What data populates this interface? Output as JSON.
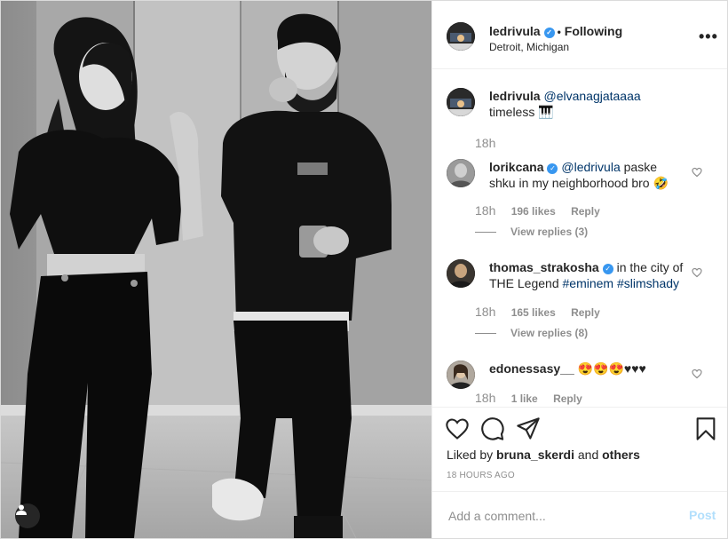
{
  "post": {
    "author": {
      "username": "ledrivula",
      "verified": true,
      "follow_status": "Following",
      "location": "Detroit, Michigan",
      "avatar_icon": "avatar-ledrivula"
    },
    "more_icon": "more-options-icon",
    "caption": {
      "username": "ledrivula",
      "mention": "@elvanagjataaaa",
      "text": "timeless",
      "emoji": "🎹",
      "time": "18h"
    },
    "comments": [
      {
        "username": "lorikcana",
        "verified": true,
        "mention": "@ledrivula",
        "text": "paske shku in my neighborhood bro",
        "emoji": "🤣",
        "time": "18h",
        "likes": "196 likes",
        "reply_label": "Reply",
        "view_replies": "View replies (3)"
      },
      {
        "username": "thomas_strakosha",
        "verified": true,
        "text": "in the city of THE Legend",
        "hashtags": [
          "#eminem",
          "#slimshady"
        ],
        "time": "18h",
        "likes": "165 likes",
        "reply_label": "Reply",
        "view_replies": "View replies (8)"
      },
      {
        "username": "edonessasy__",
        "verified": false,
        "text": "😍😍😍♥♥♥",
        "time": "18h",
        "likes": "1 like",
        "reply_label": "Reply"
      }
    ],
    "actions": {
      "like_icon": "heart-icon",
      "comment_icon": "comment-icon",
      "share_icon": "share-icon",
      "save_icon": "bookmark-icon"
    },
    "liked_by": {
      "prefix": "Liked by",
      "user": "bruna_skerdi",
      "conj": "and",
      "others": "others"
    },
    "posted_ago": "18 HOURS AGO",
    "add_comment": {
      "placeholder": "Add a comment...",
      "post_label": "Post"
    },
    "photo": {
      "tag_icon": "user-tag-icon"
    }
  }
}
